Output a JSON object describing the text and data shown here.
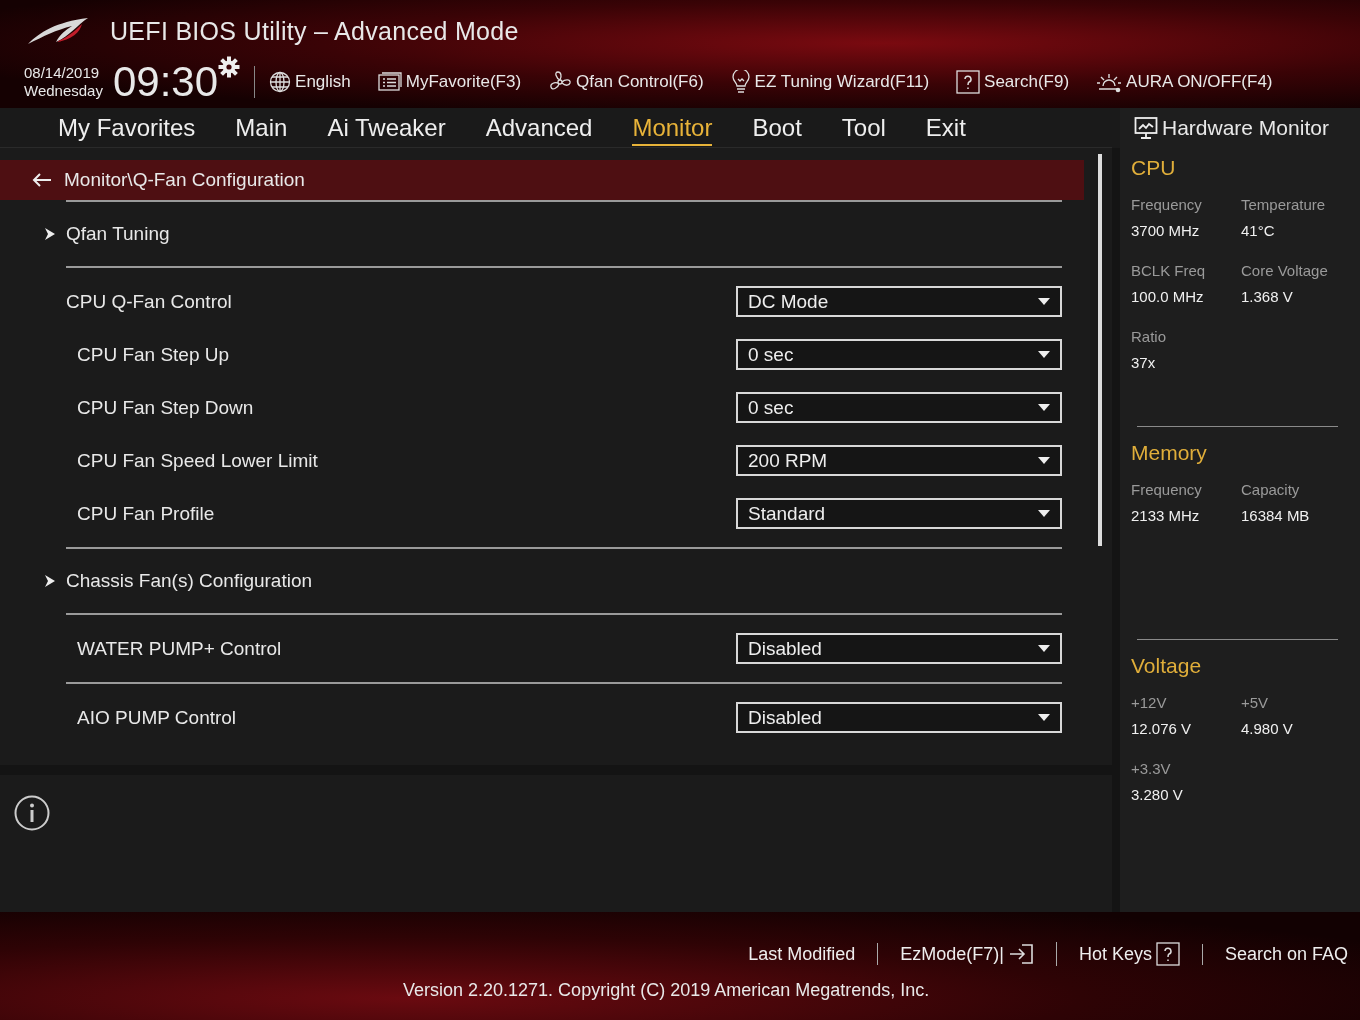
{
  "window": {
    "title": "UEFI BIOS Utility – Advanced Mode"
  },
  "header": {
    "date": "08/14/2019",
    "day": "Wednesday",
    "time": "09:30",
    "toolbar": [
      {
        "kind": "globe",
        "label": "English"
      },
      {
        "kind": "favorite",
        "label": "MyFavorite(F3)"
      },
      {
        "kind": "fan",
        "label": "Qfan Control(F6)"
      },
      {
        "kind": "bulb",
        "label": "EZ Tuning Wizard(F11)"
      },
      {
        "kind": "help",
        "label": "Search(F9)"
      },
      {
        "kind": "aura",
        "label": "AURA ON/OFF(F4)"
      }
    ]
  },
  "tabs": [
    {
      "label": "My Favorites",
      "selected": false
    },
    {
      "label": "Main",
      "selected": false
    },
    {
      "label": "Ai Tweaker",
      "selected": false
    },
    {
      "label": "Advanced",
      "selected": false
    },
    {
      "label": "Monitor",
      "selected": true
    },
    {
      "label": "Boot",
      "selected": false
    },
    {
      "label": "Tool",
      "selected": false
    },
    {
      "label": "Exit",
      "selected": false
    }
  ],
  "breadcrumb": "Monitor\\Q-Fan Configuration",
  "groups": [
    [
      {
        "kind": "submenu",
        "label": "Qfan Tuning"
      }
    ],
    [
      {
        "kind": "setting",
        "label": "CPU Q-Fan Control",
        "value": "DC Mode"
      },
      {
        "kind": "subsetting",
        "label": "CPU Fan Step Up",
        "value": "0 sec"
      },
      {
        "kind": "subsetting",
        "label": "CPU Fan Step Down",
        "value": "0 sec"
      },
      {
        "kind": "subsetting",
        "label": "CPU Fan Speed Lower Limit",
        "value": "200 RPM"
      },
      {
        "kind": "subsetting",
        "label": "CPU Fan Profile",
        "value": "Standard"
      }
    ],
    [
      {
        "kind": "submenu",
        "label": "Chassis Fan(s) Configuration"
      }
    ],
    [
      {
        "kind": "subsetting",
        "label": "WATER PUMP+ Control",
        "value": "Disabled"
      }
    ],
    [
      {
        "kind": "subsetting",
        "label": "AIO PUMP Control",
        "value": "Disabled"
      }
    ]
  ],
  "hardware_monitor": {
    "title": "Hardware Monitor",
    "sections": [
      {
        "title": "CPU",
        "items": [
          {
            "label": "Frequency",
            "value": "3700 MHz"
          },
          {
            "label": "Temperature",
            "value": "41°C"
          },
          {
            "label": "BCLK Freq",
            "value": "100.0 MHz"
          },
          {
            "label": "Core Voltage",
            "value": "1.368 V"
          },
          {
            "label": "Ratio",
            "value": "37x"
          }
        ]
      },
      {
        "title": "Memory",
        "items": [
          {
            "label": "Frequency",
            "value": "2133 MHz"
          },
          {
            "label": "Capacity",
            "value": "16384 MB"
          }
        ]
      },
      {
        "title": "Voltage",
        "items": [
          {
            "label": "+12V",
            "value": "12.076 V"
          },
          {
            "label": "+5V",
            "value": "4.980 V"
          },
          {
            "label": "+3.3V",
            "value": "3.280 V"
          }
        ]
      }
    ]
  },
  "footer": {
    "links": [
      {
        "kind": "plain",
        "label": "Last Modified"
      },
      {
        "kind": "exit",
        "label": "EzMode(F7)|"
      },
      {
        "kind": "help",
        "label": "Hot Keys"
      },
      {
        "kind": "plain",
        "label": "Search on FAQ"
      }
    ],
    "version": "Version 2.20.1271. Copyright (C) 2019 American Megatrends, Inc."
  }
}
